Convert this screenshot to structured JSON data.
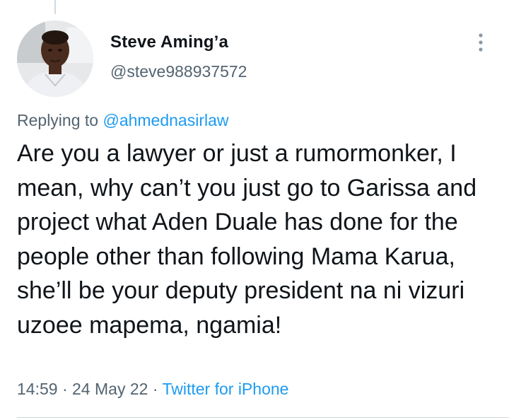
{
  "tweet": {
    "author": {
      "display_name": "Steve Aming’a",
      "handle": "@steve988937572"
    },
    "replying_prefix": "Replying to",
    "replying_to": "@ahmednasirlaw",
    "text": "Are you a lawyer or just a rumormonker, I mean, why can’t you just go to Garissa and project what Aden Duale has done for the people other than following Mama Karua, she’ll be your deputy president na ni vizuri uzoee mapema, ngamia!",
    "time": "14:59",
    "separator": "·",
    "date": "24 May 22",
    "source": "Twitter for iPhone"
  },
  "icons": {
    "more": "more-vertical-icon"
  },
  "colors": {
    "accent": "#1d9bf0",
    "secondary_text": "#536471",
    "primary_text": "#0f1419"
  }
}
